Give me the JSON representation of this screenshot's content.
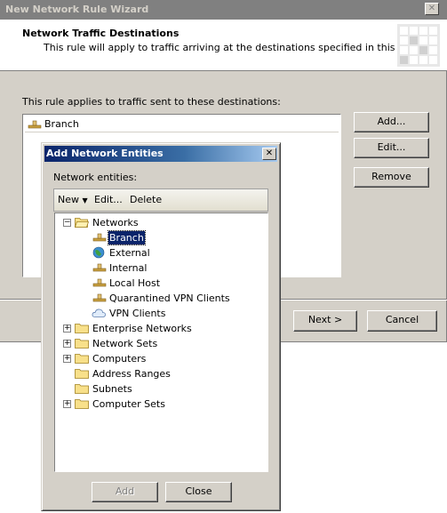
{
  "wizard": {
    "title": "New Network Rule Wizard",
    "header_title": "Network Traffic Destinations",
    "header_subtitle": "This rule will apply to traffic arriving at the destinations specified in this page.",
    "applies_label": "This rule applies to traffic sent to these destinations:",
    "destinations": [
      "Branch"
    ],
    "buttons": {
      "add": "Add...",
      "edit": "Edit...",
      "remove": "Remove",
      "next": "Next >",
      "cancel": "Cancel"
    }
  },
  "dialog": {
    "title": "Add Network Entities",
    "entities_label": "Network entities:",
    "toolbar": {
      "new": "New",
      "edit": "Edit...",
      "delete": "Delete"
    },
    "tree": {
      "networks_label": "Networks",
      "networks": [
        {
          "label": "Branch",
          "icon": "network-icon",
          "selected": true
        },
        {
          "label": "External",
          "icon": "globe-icon",
          "selected": false
        },
        {
          "label": "Internal",
          "icon": "network-icon",
          "selected": false
        },
        {
          "label": "Local Host",
          "icon": "network-icon",
          "selected": false
        },
        {
          "label": "Quarantined VPN Clients",
          "icon": "network-icon",
          "selected": false
        },
        {
          "label": "VPN Clients",
          "icon": "cloud-icon",
          "selected": false
        }
      ],
      "folders": [
        {
          "label": "Enterprise Networks",
          "expandable": true
        },
        {
          "label": "Network Sets",
          "expandable": true
        },
        {
          "label": "Computers",
          "expandable": true
        },
        {
          "label": "Address Ranges",
          "expandable": false
        },
        {
          "label": "Subnets",
          "expandable": false
        },
        {
          "label": "Computer Sets",
          "expandable": true
        }
      ]
    },
    "buttons": {
      "add": "Add",
      "close": "Close"
    }
  }
}
